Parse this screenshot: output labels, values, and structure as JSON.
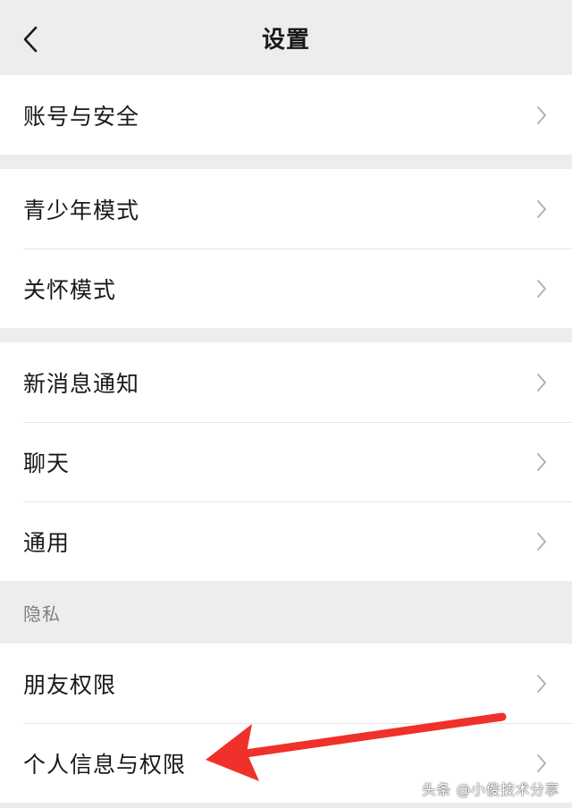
{
  "nav": {
    "title": "设置",
    "back_icon": "chevron-left-icon"
  },
  "groups": [
    {
      "items": [
        {
          "label": "账号与安全"
        }
      ]
    },
    {
      "items": [
        {
          "label": "青少年模式"
        },
        {
          "label": "关怀模式"
        }
      ]
    },
    {
      "items": [
        {
          "label": "新消息通知"
        },
        {
          "label": "聊天"
        },
        {
          "label": "通用"
        }
      ]
    }
  ],
  "privacy": {
    "section_title": "隐私",
    "items": [
      {
        "label": "朋友权限"
      },
      {
        "label": "个人信息与权限"
      }
    ]
  },
  "annotation": {
    "arrow_color": "#f0302a",
    "points_to": "个人信息与权限"
  },
  "watermark": "头条 @小俊技术分享",
  "colors": {
    "background": "#ededed",
    "cell_background": "#ffffff",
    "text": "#191919",
    "secondary_text": "#7f7f7f",
    "chevron": "#b2b2b2",
    "separator": "#e5e5e5"
  }
}
